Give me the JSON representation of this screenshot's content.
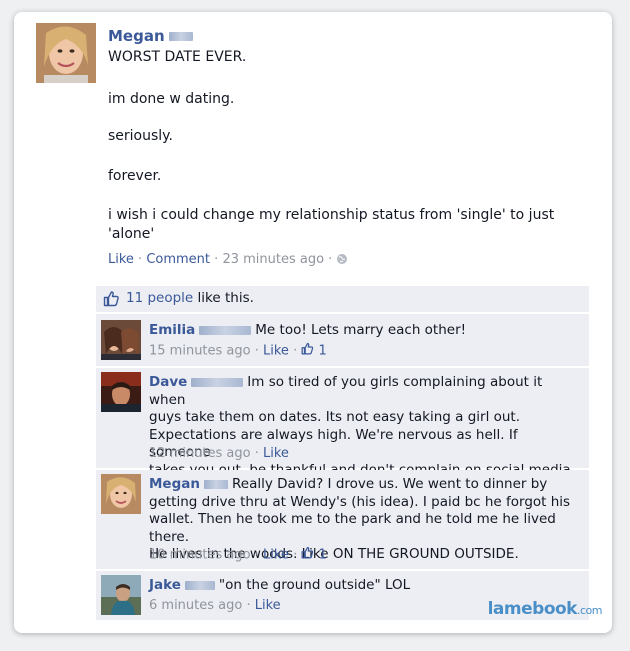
{
  "post": {
    "author": "Megan",
    "lines": [
      "WORST DATE EVER.",
      "im done w dating.",
      "seriously.",
      "forever.",
      "i wish i could change my relationship status from 'single' to just",
      "'alone'"
    ],
    "like_label": "Like",
    "comment_label": "Comment",
    "time": "23 minutes ago",
    "separator": " · "
  },
  "likes": {
    "count_text": "11 people",
    "suffix": "like this."
  },
  "comments": [
    {
      "author": "Emilia",
      "lines": [
        "Me too! Lets marry each other!"
      ],
      "time": "15 minutes ago",
      "like_label": "Like",
      "like_count": "1"
    },
    {
      "author": "Dave",
      "lines": [
        "Im so tired of you girls complaining about it when",
        "guys take them on dates. Its not easy taking a girl out.",
        "Expectations are always high. We're nervous as hell. If someone",
        "takes you out, be thankful and don't complain on social media"
      ],
      "time": "12 minutes ago",
      "like_label": "Like"
    },
    {
      "author": "Megan",
      "lines": [
        "Really David? I drove us. We went to dinner by",
        "getting drive thru at Wendy's (his idea). I paid bc he forgot his",
        "wallet. Then he took me to the park and he told me he lived there.",
        "He lives in the woods. Like ON THE GROUND OUTSIDE."
      ],
      "time": "10 minutes ago",
      "like_label": "Like",
      "like_count": "1"
    },
    {
      "author": "Jake",
      "lines": [
        "\"on the ground outside\" LOL"
      ],
      "time": "6 minutes ago",
      "like_label": "Like"
    }
  ],
  "watermark": {
    "brand": "lamebook",
    "tld": ".com"
  },
  "colors": {
    "link": "#3b5998",
    "meta": "#90949c",
    "comment_bg": "#eceef4",
    "watermark": "#4a8fc7"
  }
}
